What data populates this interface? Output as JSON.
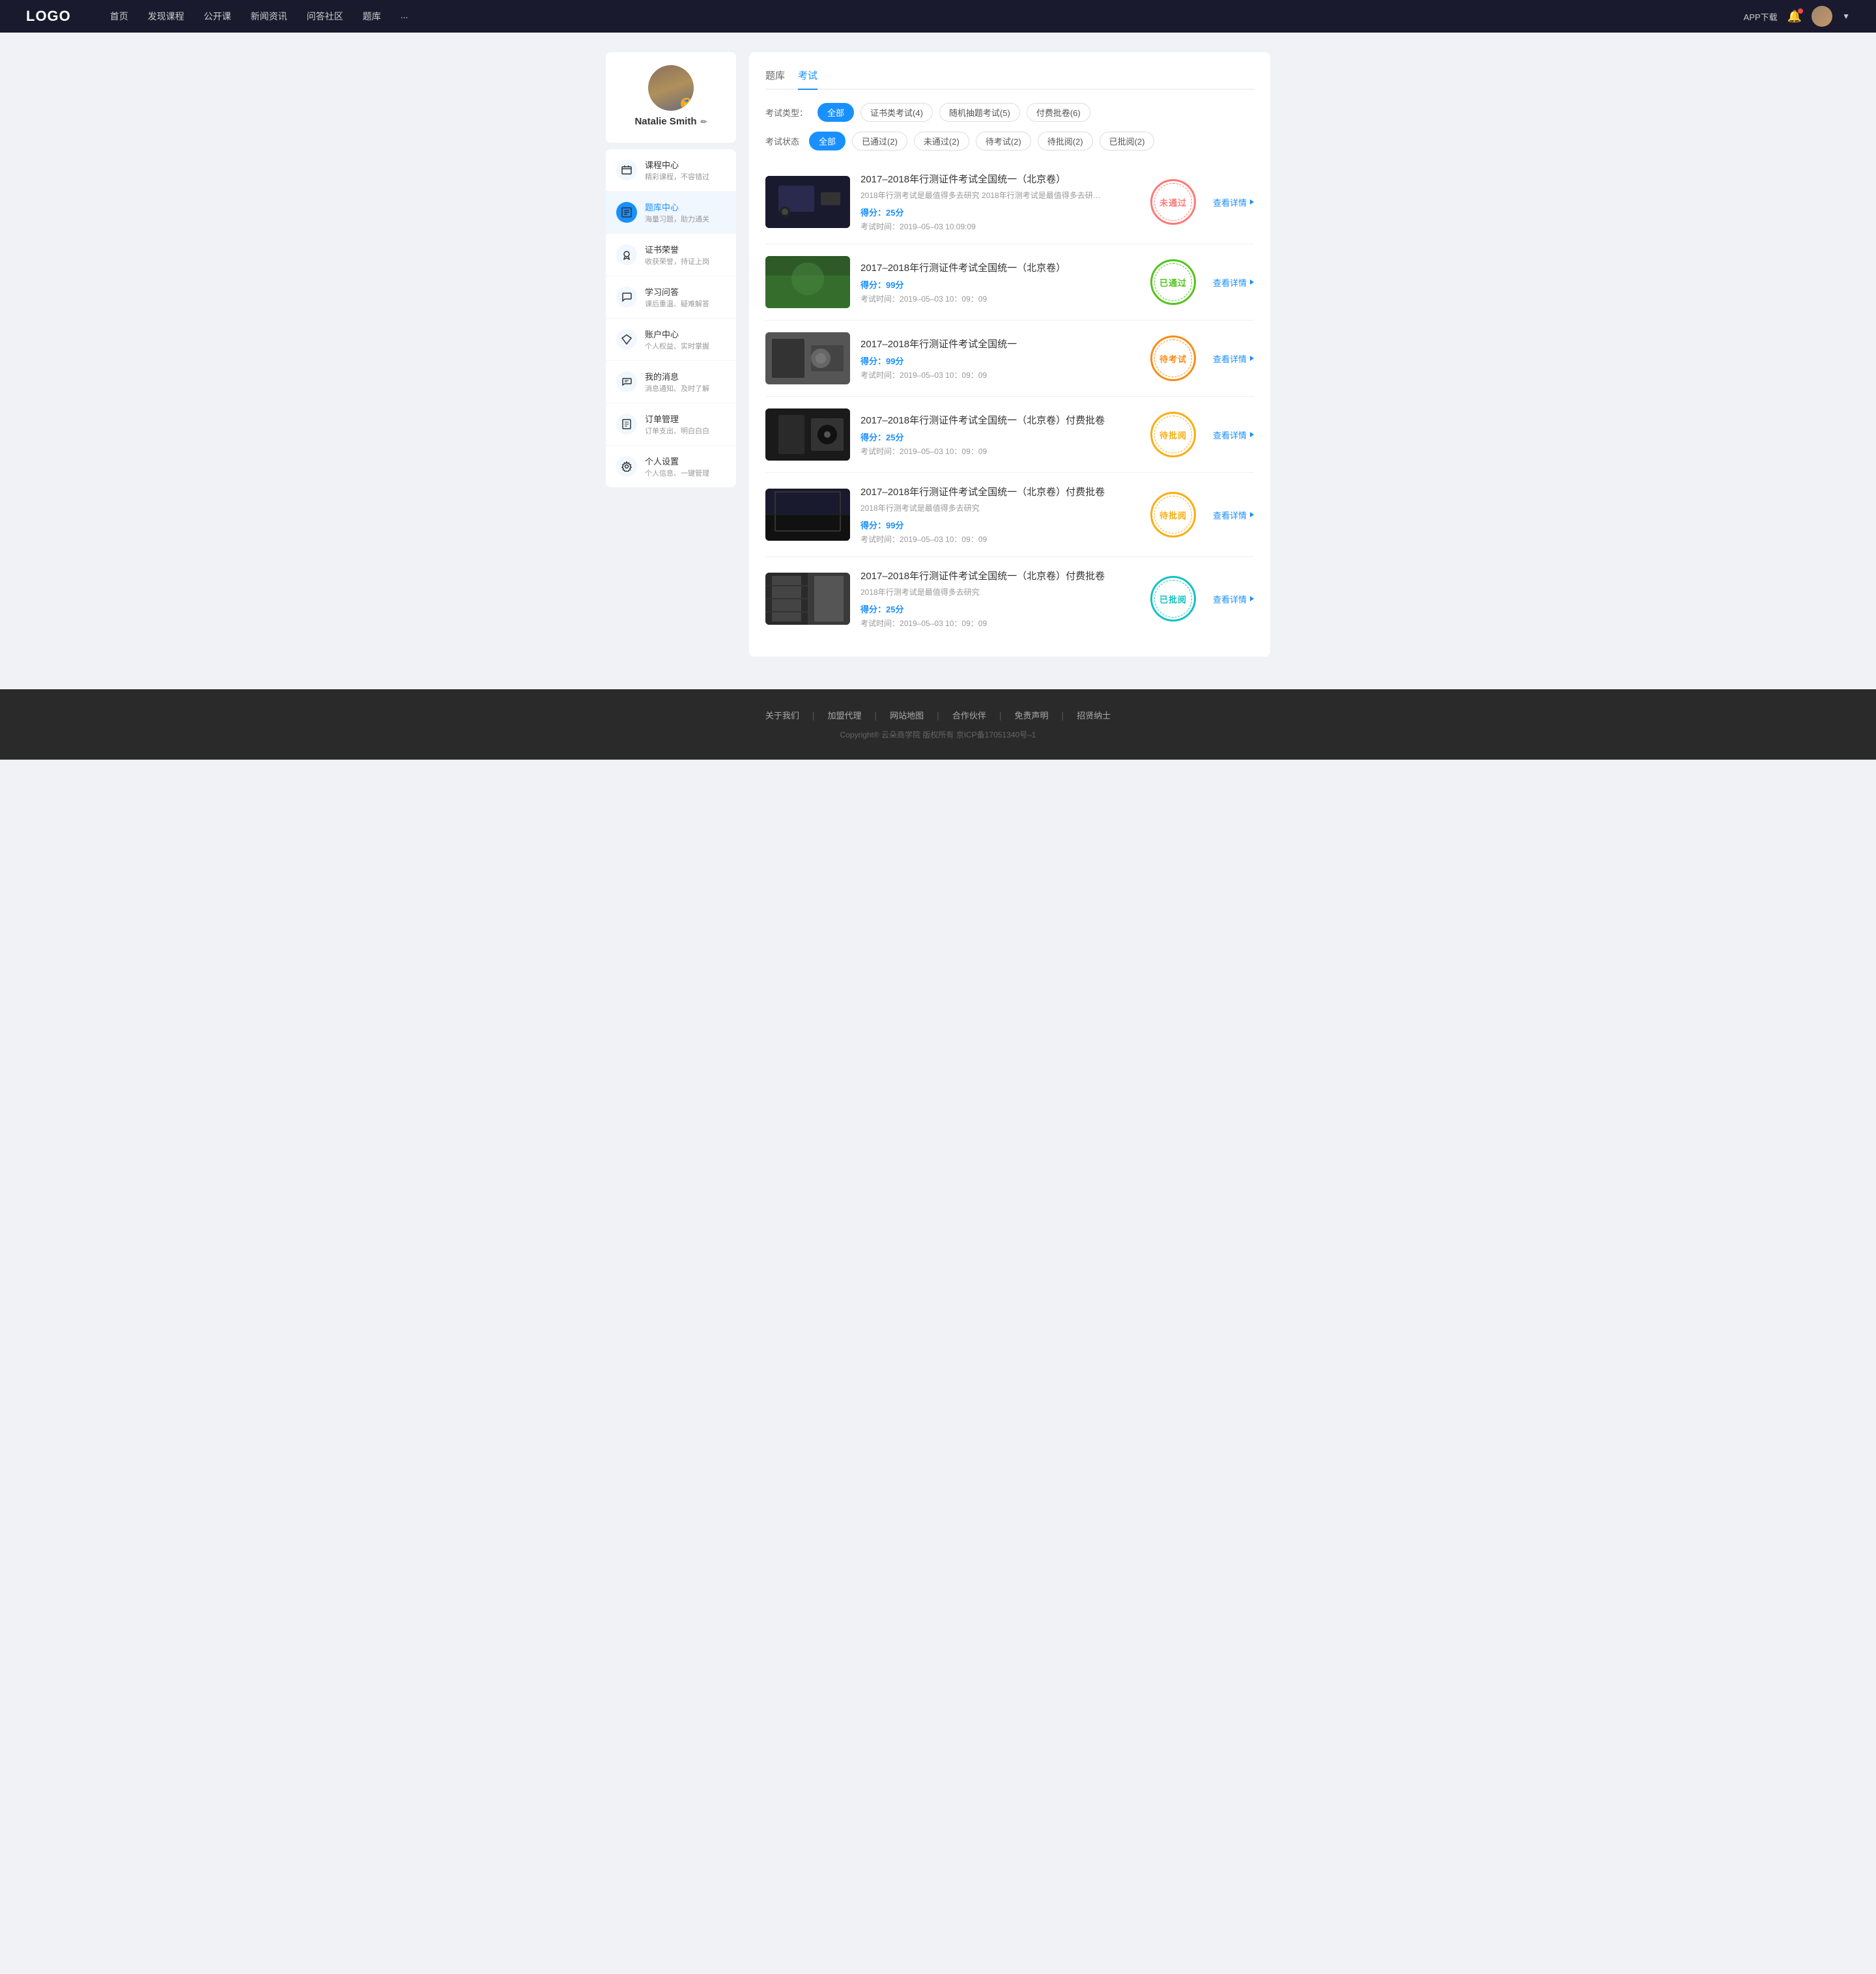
{
  "header": {
    "logo": "LOGO",
    "nav": [
      "首页",
      "发现课程",
      "公开课",
      "新闻资讯",
      "问答社区",
      "题库",
      "..."
    ],
    "app_download": "APP下载",
    "chevron": "▼"
  },
  "sidebar": {
    "user": {
      "name": "Natalie Smith",
      "edit_icon": "✏"
    },
    "menu": [
      {
        "id": "course",
        "title": "课程中心",
        "subtitle": "精彩课程，不容错过",
        "icon": "calendar"
      },
      {
        "id": "question",
        "title": "题库中心",
        "subtitle": "海量习题，助力通关",
        "icon": "list",
        "active": true
      },
      {
        "id": "cert",
        "title": "证书荣誉",
        "subtitle": "收获荣誉，持证上岗",
        "icon": "cert"
      },
      {
        "id": "qa",
        "title": "学习问答",
        "subtitle": "课后重温、疑难解答",
        "icon": "chat"
      },
      {
        "id": "account",
        "title": "账户中心",
        "subtitle": "个人权益、实时掌握",
        "icon": "diamond"
      },
      {
        "id": "message",
        "title": "我的消息",
        "subtitle": "消息通知、及时了解",
        "icon": "message"
      },
      {
        "id": "order",
        "title": "订单管理",
        "subtitle": "订单支出、明白白白",
        "icon": "order"
      },
      {
        "id": "settings",
        "title": "个人设置",
        "subtitle": "个人信息、一键管理",
        "icon": "gear"
      }
    ]
  },
  "content": {
    "tabs": [
      "题库",
      "考试"
    ],
    "active_tab": "考试",
    "exam_type": {
      "label": "考试类型：",
      "options": [
        {
          "label": "全部",
          "active": true
        },
        {
          "label": "证书类考试(4)",
          "active": false
        },
        {
          "label": "随机抽题考试(5)",
          "active": false
        },
        {
          "label": "付费批卷(6)",
          "active": false
        }
      ]
    },
    "exam_status": {
      "label": "考试状态",
      "options": [
        {
          "label": "全部",
          "active": true
        },
        {
          "label": "已通过(2)",
          "active": false
        },
        {
          "label": "未通过(2)",
          "active": false
        },
        {
          "label": "待考试(2)",
          "active": false
        },
        {
          "label": "待批阅(2)",
          "active": false
        },
        {
          "label": "已批阅(2)",
          "active": false
        }
      ]
    },
    "exams": [
      {
        "id": 1,
        "title": "2017–2018年行测证件考试全国统一（北京卷）",
        "desc": "2018年行测考试是最值得多去研究 2018年行测考试是最值得多去研究 2018年行...",
        "score_label": "得分：",
        "score": "25",
        "score_unit": "分",
        "time_label": "考试时间：",
        "time": "2019–05–03  10:09:09",
        "status": "not-passed",
        "status_text": "未通过",
        "action": "查看详情"
      },
      {
        "id": 2,
        "title": "2017–2018年行测证件考试全国统一（北京卷）",
        "desc": "",
        "score_label": "得分：",
        "score": "99",
        "score_unit": "分",
        "time_label": "考试时间：",
        "time": "2019–05–03  10：09：09",
        "status": "passed",
        "status_text": "已通过",
        "action": "查看详情"
      },
      {
        "id": 3,
        "title": "2017–2018年行测证件考试全国统一",
        "desc": "",
        "score_label": "得分：",
        "score": "99",
        "score_unit": "分",
        "time_label": "考试时间：",
        "time": "2019–05–03  10：09：09",
        "status": "pending",
        "status_text": "待考试",
        "action": "查看详情"
      },
      {
        "id": 4,
        "title": "2017–2018年行测证件考试全国统一（北京卷）付费批卷",
        "desc": "",
        "score_label": "得分：",
        "score": "25",
        "score_unit": "分",
        "time_label": "考试时间：",
        "time": "2019–05–03  10：09：09",
        "status": "reviewing",
        "status_text": "待批阅",
        "action": "查看详情"
      },
      {
        "id": 5,
        "title": "2017–2018年行测证件考试全国统一（北京卷）付费批卷",
        "desc": "2018年行测考试是最值得多去研究",
        "score_label": "得分：",
        "score": "99",
        "score_unit": "分",
        "time_label": "考试时间：",
        "time": "2019–05–03  10：09：09",
        "status": "reviewing",
        "status_text": "待批阅",
        "action": "查看详情"
      },
      {
        "id": 6,
        "title": "2017–2018年行测证件考试全国统一（北京卷）付费批卷",
        "desc": "2018年行测考试是最值得多去研究",
        "score_label": "得分：",
        "score": "25",
        "score_unit": "分",
        "time_label": "考试时间：",
        "time": "2019–05–03  10：09：09",
        "status": "reviewed",
        "status_text": "已批阅",
        "action": "查看详情"
      }
    ]
  },
  "footer": {
    "links": [
      "关于我们",
      "加盟代理",
      "网站地图",
      "合作伙伴",
      "免责声明",
      "招贤纳士"
    ],
    "copyright": "Copyright® 云朵商学院  版权所有    京ICP备17051340号–1"
  }
}
